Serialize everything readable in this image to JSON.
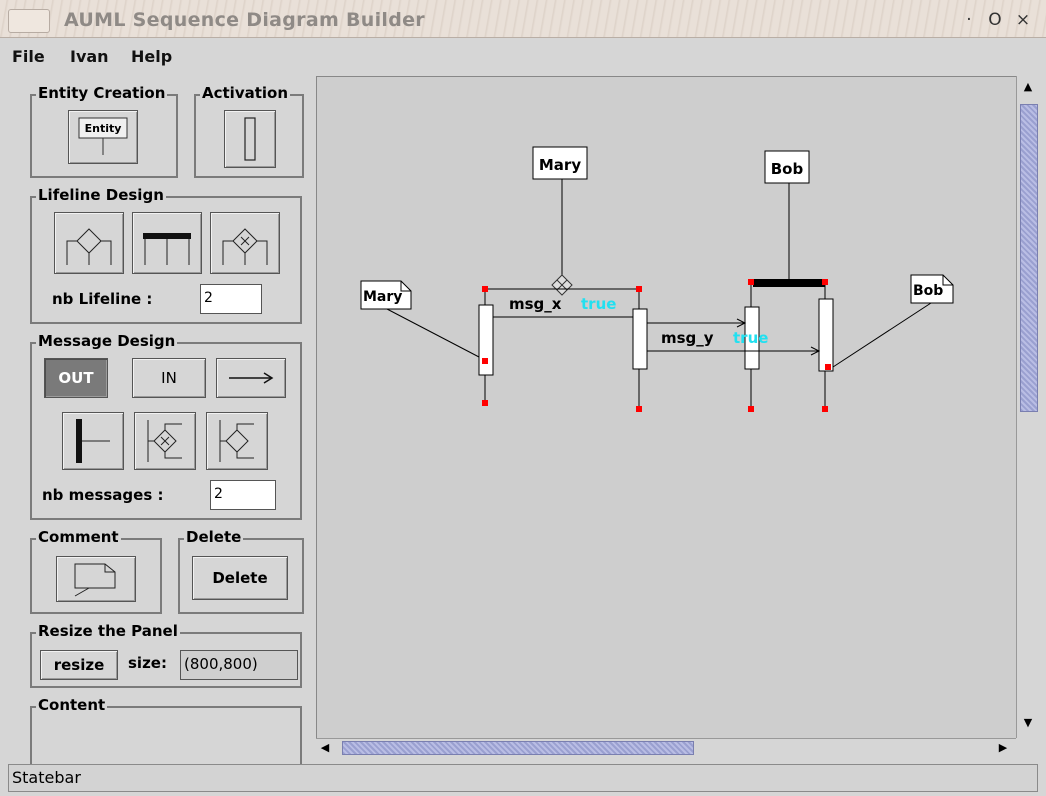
{
  "window": {
    "title": "AUML Sequence Diagram Builder"
  },
  "titlebar_buttons": [
    "·",
    "O",
    "×"
  ],
  "menu": [
    "File",
    "Ivan",
    "Help"
  ],
  "entity_creation": {
    "title": "Entity Creation",
    "icon_text": "Entity"
  },
  "activation": {
    "title": "Activation"
  },
  "lifeline_design": {
    "title": "Lifeline Design",
    "nb_label": "nb Lifeline :",
    "nb_value": "2"
  },
  "message_design": {
    "title": "Message Design",
    "out_label": "OUT",
    "in_label": "IN",
    "nb_label": "nb messages :",
    "nb_value": "2"
  },
  "comment": {
    "title": "Comment"
  },
  "delete": {
    "title": "Delete",
    "button": "Delete"
  },
  "resize_panel": {
    "title": "Resize the Panel",
    "button": "resize",
    "size_label": "size:",
    "size_value": "(800,800)"
  },
  "content": {
    "title": "Content"
  },
  "diagram": {
    "entities": [
      "Mary",
      "Bob"
    ],
    "actors": [
      "Mary",
      "Bob"
    ],
    "messages": [
      {
        "name": "msg_x",
        "guard": "true"
      },
      {
        "name": "msg_y",
        "guard": "true"
      }
    ]
  },
  "statusbar": "Statebar",
  "colors": {
    "guard": "#22e0f0",
    "handle": "#ff0000",
    "canvas": "#cecece"
  }
}
